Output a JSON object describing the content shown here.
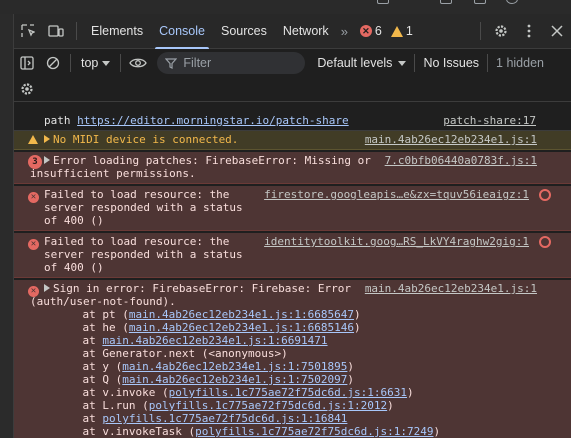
{
  "tabs": {
    "items": [
      {
        "label": "Elements"
      },
      {
        "label": "Console"
      },
      {
        "label": "Sources"
      },
      {
        "label": "Network"
      }
    ],
    "more": "»",
    "error_count": "6",
    "warning_count": "1"
  },
  "toolbar": {
    "context": "top",
    "filter_placeholder": "Filter",
    "levels": "Default levels",
    "issues": "No Issues",
    "hidden": "1 hidden"
  },
  "messages": [
    {
      "type": "log",
      "text": "path ",
      "link": "https://editor.morningstar.io/patch-share",
      "source": "patch-share:17"
    },
    {
      "type": "warning",
      "text": "No MIDI device is connected.",
      "source": "main.4ab26ec12eb234e1.js:1"
    },
    {
      "type": "error",
      "repeat": "3",
      "text_line1": "Error loading patches: FirebaseError: Missing or",
      "text_line2": "insufficient permissions.",
      "source": "7.c0bfb06440a0783f.js:1"
    },
    {
      "type": "error",
      "text_lines": [
        "Failed to load resource: the",
        "server responded with a status",
        "of 400 ()"
      ],
      "source": "firestore.googleapis…e&zx=tquv56ieaigz:1"
    },
    {
      "type": "error",
      "text_lines": [
        "Failed to load resource: the",
        "server responded with a status",
        "of 400 ()"
      ],
      "source": "identitytoolkit.goog…RS_LkVY4raghw2gig:1"
    },
    {
      "type": "error",
      "text_line1": "Sign in error: FirebaseError: Firebase: Error",
      "text_line2": "(auth/user-not-found).",
      "source": "main.4ab26ec12eb234e1.js:1",
      "stack": [
        {
          "prefix": "    at pt (",
          "link": "main.4ab26ec12eb234e1.js:1:6685647",
          "suffix": ")"
        },
        {
          "prefix": "    at he (",
          "link": "main.4ab26ec12eb234e1.js:1:6685146",
          "suffix": ")"
        },
        {
          "prefix": "    at ",
          "link": "main.4ab26ec12eb234e1.js:1:6691471",
          "suffix": ""
        },
        {
          "prefix": "    at Generator.next (<anonymous>)",
          "link": "",
          "suffix": ""
        },
        {
          "prefix": "    at y (",
          "link": "main.4ab26ec12eb234e1.js:1:7501895",
          "suffix": ")"
        },
        {
          "prefix": "    at Q (",
          "link": "main.4ab26ec12eb234e1.js:1:7502097",
          "suffix": ")"
        },
        {
          "prefix": "    at v.invoke (",
          "link": "polyfills.1c775ae72f75dc6d.js:1:6631",
          "suffix": ")"
        },
        {
          "prefix": "    at L.run (",
          "link": "polyfills.1c775ae72f75dc6d.js:1:2012",
          "suffix": ")"
        },
        {
          "prefix": "    at ",
          "link": "polyfills.1c775ae72f75dc6d.js:1:16841",
          "suffix": ""
        },
        {
          "prefix": "    at v.invokeTask (",
          "link": "polyfills.1c775ae72f75dc6d.js:1:7249",
          "suffix": ")"
        }
      ]
    }
  ]
}
